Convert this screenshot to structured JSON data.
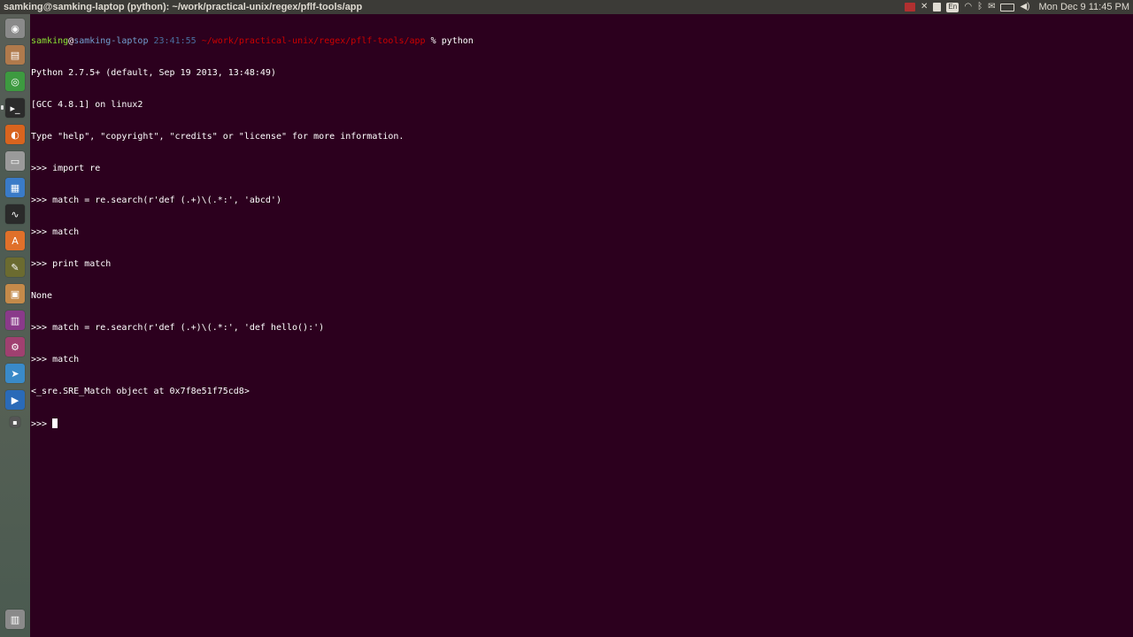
{
  "window": {
    "title": "samking@samking-laptop (python): ~/work/practical-unix/regex/pflf-tools/app"
  },
  "panel": {
    "keyboard_layout": "En",
    "clock": "Mon Dec 9  11:45 PM",
    "indicators": [
      "record-icon",
      "tools-icon",
      "notes-icon",
      "keyboard-icon",
      "wifi-icon",
      "bluetooth-icon",
      "mail-icon",
      "battery-icon",
      "volume-icon"
    ]
  },
  "launcher": {
    "items": [
      {
        "name": "ubuntu-dash-icon",
        "glyph": "◉",
        "color": "#8a8a8a"
      },
      {
        "name": "files-icon",
        "glyph": "▤",
        "color": "#b07a4c"
      },
      {
        "name": "chrome-icon",
        "glyph": "◎",
        "color": "#3d9a40"
      },
      {
        "name": "terminal-icon",
        "glyph": "▸_",
        "color": "#2b2b2b"
      },
      {
        "name": "firefox-icon",
        "glyph": "◐",
        "color": "#d8641e"
      },
      {
        "name": "drive-icon",
        "glyph": "▭",
        "color": "#9a9a9a"
      },
      {
        "name": "document-icon",
        "glyph": "▦",
        "color": "#3a7bc8"
      },
      {
        "name": "system-monitor-icon",
        "glyph": "∿",
        "color": "#2a2a2a"
      },
      {
        "name": "software-center-icon",
        "glyph": "A",
        "color": "#e0702a"
      },
      {
        "name": "screenshot-icon",
        "glyph": "✎",
        "color": "#6b6b30"
      },
      {
        "name": "archive-icon",
        "glyph": "▣",
        "color": "#c48a4a"
      },
      {
        "name": "workspace-icon",
        "glyph": "▥",
        "color": "#8a3a8a"
      },
      {
        "name": "settings-icon",
        "glyph": "⚙",
        "color": "#a04070"
      },
      {
        "name": "remote-desktop-icon",
        "glyph": "➤",
        "color": "#3a8ac8"
      },
      {
        "name": "media-player-icon",
        "glyph": "▶",
        "color": "#2a6ab8"
      },
      {
        "name": "small-app-icon",
        "glyph": "▪",
        "color": "#555555"
      },
      {
        "name": "trash-icon",
        "glyph": "▥",
        "color": "#8a8a8a"
      }
    ]
  },
  "terminal": {
    "prompt": {
      "user": "samking",
      "at": "@",
      "host": "samking-laptop",
      "time": "23:41:55",
      "dir": "~/work/practical-unix/regex/pflf-tools/app",
      "symbol": "%",
      "command": "python"
    },
    "lines": [
      "Python 2.7.5+ (default, Sep 19 2013, 13:48:49)",
      "[GCC 4.8.1] on linux2",
      "Type \"help\", \"copyright\", \"credits\" or \"license\" for more information.",
      ">>> import re",
      ">>> match = re.search(r'def (.+)\\(.*:', 'abcd')",
      ">>> match",
      ">>> print match",
      "None",
      ">>> match = re.search(r'def (.+)\\(.*:', 'def hello():')",
      ">>> match",
      "<_sre.SRE_Match object at 0x7f8e51f75cd8>"
    ],
    "input_prompt": ">>> "
  }
}
